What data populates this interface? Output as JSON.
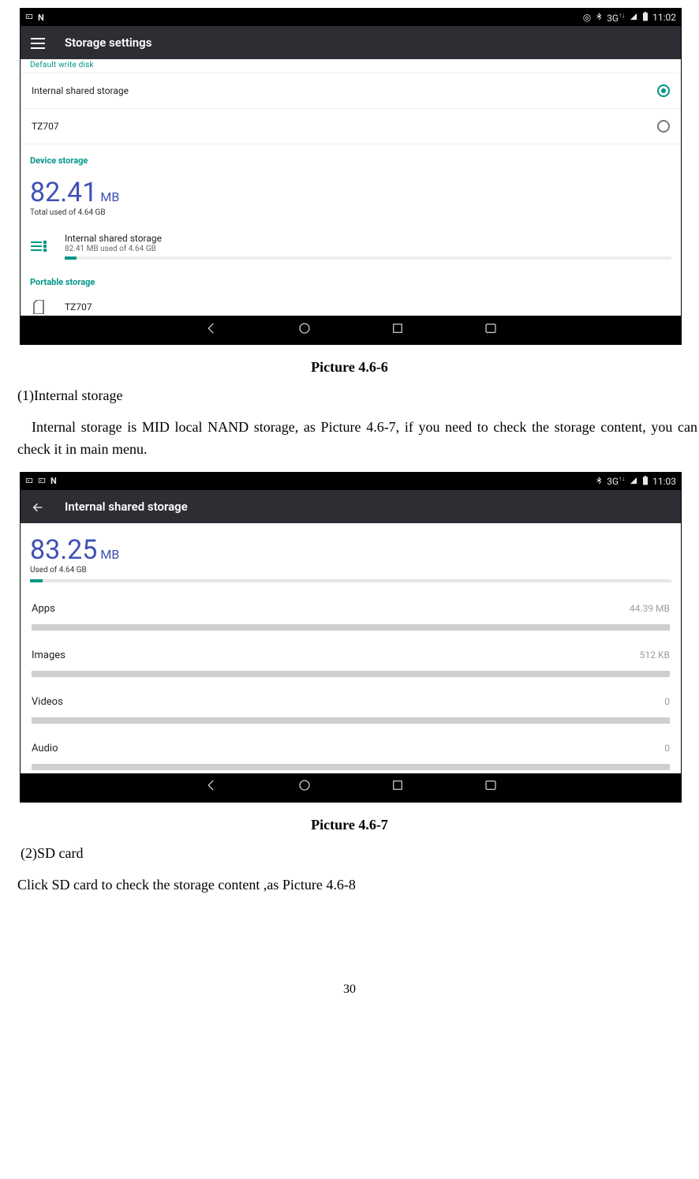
{
  "screenshot1": {
    "status": {
      "time": "11:02",
      "signal": "3G"
    },
    "appbar": {
      "title": "Storage settings"
    },
    "section_cut": "Default write disk",
    "radios": [
      {
        "label": "Internal shared storage",
        "selected": true
      },
      {
        "label": "TZ707",
        "selected": false
      }
    ],
    "device_header": "Device storage",
    "usage": {
      "value": "82.41",
      "unit": "MB",
      "sub": "Total used of 4.64 GB"
    },
    "internal_item": {
      "title": "Internal shared storage",
      "sub": "82.41 MB used of 4.64 GB"
    },
    "portable_header": "Portable storage",
    "portable_item": {
      "title": "TZ707"
    }
  },
  "caption1": "Picture 4.6-6",
  "text1_heading": "(1)Internal storage",
  "text1_para": "Internal storage is MID local NAND storage, as Picture 4.6-7, if you need to check the storage content, you can check it in main menu.",
  "screenshot2": {
    "status": {
      "time": "11:03",
      "signal": "3G"
    },
    "appbar": {
      "title": "Internal shared storage"
    },
    "usage": {
      "value": "83.25",
      "unit": "MB",
      "sub": "Used of 4.64 GB"
    },
    "categories": [
      {
        "name": "Apps",
        "value": "44.39 MB"
      },
      {
        "name": "Images",
        "value": "512 KB"
      },
      {
        "name": "Videos",
        "value": "0"
      },
      {
        "name": "Audio",
        "value": "0"
      }
    ]
  },
  "caption2": "Picture 4.6-7",
  "text2_heading": "(2)SD card",
  "text2_para": "Click SD card to check the storage content ,as Picture 4.6-8",
  "page_number": "30"
}
